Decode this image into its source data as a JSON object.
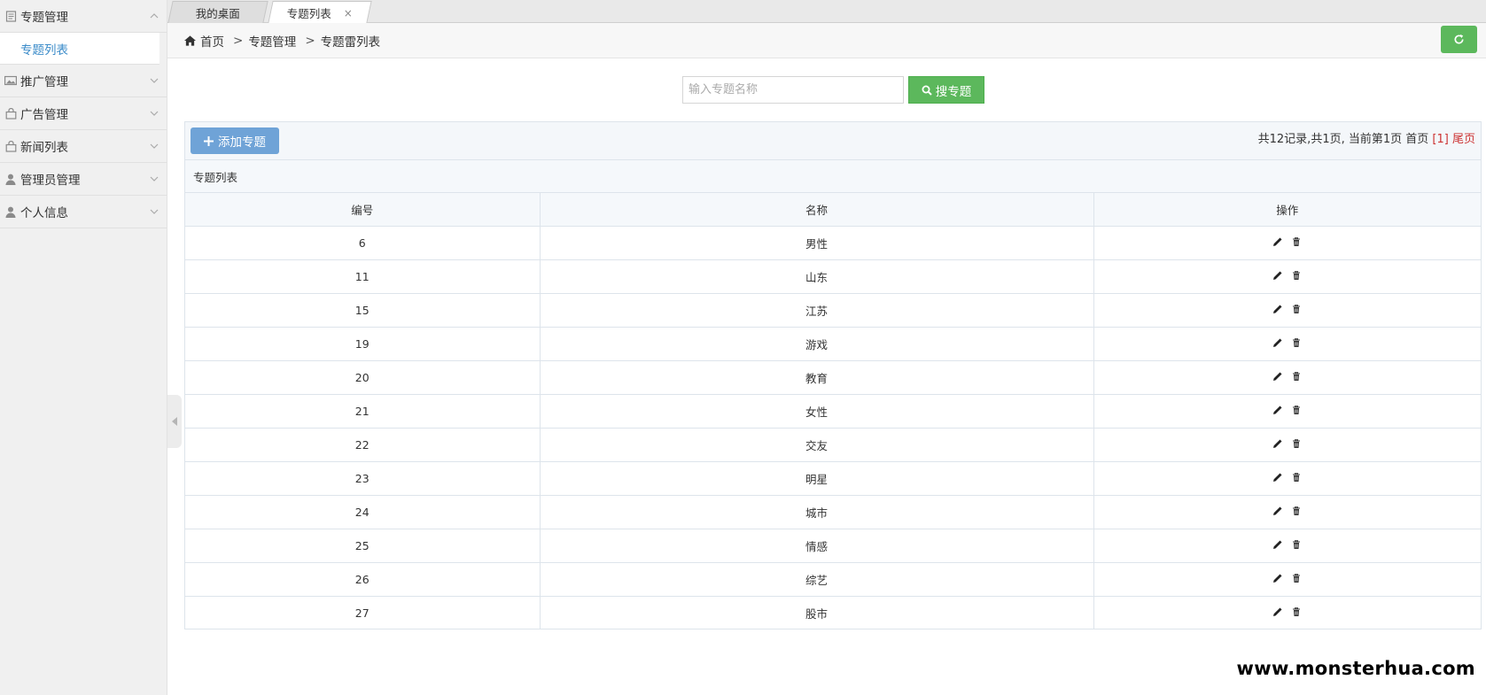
{
  "sidebar": {
    "groups": [
      {
        "label": "专题管理",
        "icon": "document-icon",
        "expanded": true,
        "sub": [
          "专题列表"
        ]
      },
      {
        "label": "推广管理",
        "icon": "image-icon",
        "expanded": false
      },
      {
        "label": "广告管理",
        "icon": "bag-icon",
        "expanded": false
      },
      {
        "label": "新闻列表",
        "icon": "bag-icon",
        "expanded": false
      },
      {
        "label": "管理员管理",
        "icon": "user-icon",
        "expanded": false
      },
      {
        "label": "个人信息",
        "icon": "user-icon",
        "expanded": false
      }
    ]
  },
  "tabs": {
    "desk": "我的桌面",
    "list": "专题列表",
    "close": "×"
  },
  "breadcrumb": {
    "home": "首页",
    "sep": ">",
    "level1": "专题管理",
    "level2": "专题雷列表"
  },
  "search": {
    "placeholder": "输入专题名称",
    "button": "搜专题"
  },
  "toolbar": {
    "add_label": "添加专题"
  },
  "pager": {
    "summary": "共12记录,共1页, 当前第1页",
    "first": "首页",
    "current": "[1]",
    "last": "尾页"
  },
  "list": {
    "title": "专题列表",
    "headers": [
      "编号",
      "名称",
      "操作"
    ],
    "rows": [
      {
        "id": "6",
        "name": "男性"
      },
      {
        "id": "11",
        "name": "山东"
      },
      {
        "id": "15",
        "name": "江苏"
      },
      {
        "id": "19",
        "name": "游戏"
      },
      {
        "id": "20",
        "name": "教育"
      },
      {
        "id": "21",
        "name": "女性"
      },
      {
        "id": "22",
        "name": "交友"
      },
      {
        "id": "23",
        "name": "明星"
      },
      {
        "id": "24",
        "name": "城市"
      },
      {
        "id": "25",
        "name": "情感"
      },
      {
        "id": "26",
        "name": "综艺"
      },
      {
        "id": "27",
        "name": "股市"
      }
    ]
  },
  "watermark": "www.monsterhua.com",
  "colors": {
    "green": "#5cb85c",
    "blue": "#6fa3d7",
    "link": "#3a8bc9",
    "pager_red": "#cc3333"
  }
}
